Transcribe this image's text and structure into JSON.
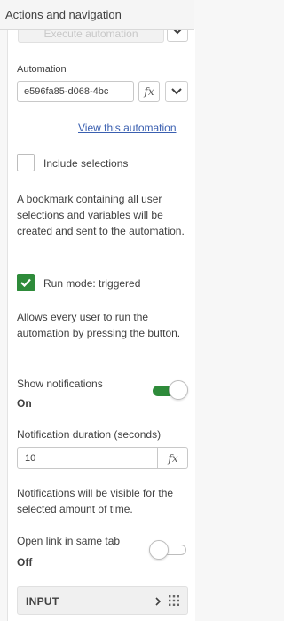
{
  "header": {
    "title": "Actions and navigation"
  },
  "top_button": {
    "label": "Execute automation"
  },
  "automation": {
    "label": "Automation",
    "value": "e596fa85-d068-4bc",
    "fx": "fx",
    "view_link": "View this automation"
  },
  "include_selections": {
    "label": "Include selections",
    "checked": false,
    "description": "A bookmark containing all user selections and variables will be created and sent to the automation."
  },
  "run_mode": {
    "label": "Run mode: triggered",
    "checked": true,
    "description": "Allows every user to run the automation by pressing the button."
  },
  "notifications": {
    "label": "Show notifications",
    "state": "On",
    "enabled": true
  },
  "notification_duration": {
    "label": "Notification duration (seconds)",
    "value": "10",
    "fx": "fx",
    "description": "Notifications will be visible for the selected amount of time."
  },
  "open_link": {
    "label": "Open link in same tab",
    "state": "Off",
    "enabled": false
  },
  "footer": {
    "label": "INPUT"
  },
  "colors": {
    "accent_green": "#2e8b3a",
    "link_blue": "#3a5fb0"
  }
}
